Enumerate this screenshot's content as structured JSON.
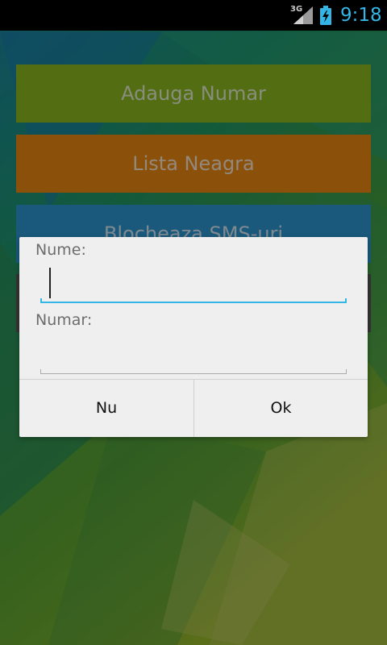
{
  "status_bar": {
    "network_type": "3G",
    "time": "9:18",
    "icons": [
      "signal-icon",
      "battery-charging-icon"
    ]
  },
  "main": {
    "buttons": [
      {
        "label": "Adauga Numar",
        "color": "#8fbc1f"
      },
      {
        "label": "Lista Neagra",
        "color": "#f08c12"
      },
      {
        "label": "Blocheaza SMS-uri",
        "color": "#2e9ad6"
      }
    ]
  },
  "dialog": {
    "name_label": "Nume:",
    "name_value": "",
    "number_label": "Numar:",
    "number_value": "",
    "cancel_label": "Nu",
    "ok_label": "Ok"
  },
  "colors": {
    "accent": "#33b5e5",
    "dialog_bg": "#efefef"
  }
}
